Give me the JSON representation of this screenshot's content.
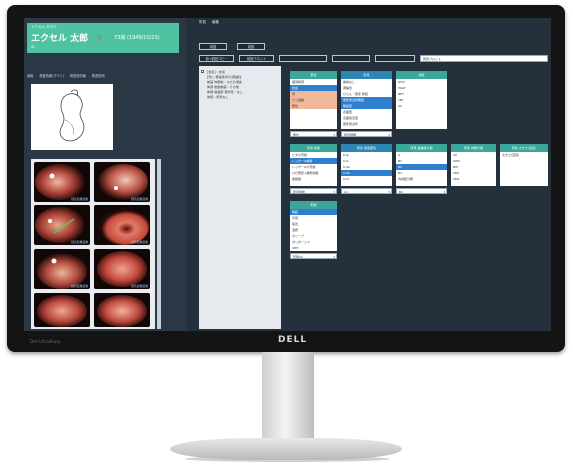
{
  "patient": {
    "kana": "エクセル タロウ",
    "name": "エクセル 太郎",
    "gender_symbol": "♀",
    "age_dob": "73歳 (1949/10/23)",
    "id": "ID"
  },
  "left_tabs": [
    "画像",
    "検査情報(すべて)",
    "検査前情報",
    "検査説明"
  ],
  "thumb_label": "検査画像画像",
  "menu": [
    "所見",
    "編集"
  ],
  "toolbar": {
    "row1": [
      "前回",
      "前回"
    ],
    "row2": [
      "前→前回コピー",
      "前回プロット",
      "",
      "",
      ""
    ],
    "field_value": "所見プロット"
  },
  "findings": [
    "[食道] : 食道",
    "[胃] : 萎縮性胃炎/萎縮性",
    "前庭 体部前 : ひだの消失",
    "体部 後壁前庭 : その他",
    "体部 前庭部 有所見 : なし",
    "体部 : 所見なし"
  ],
  "groups": {
    "region": {
      "title": "部位",
      "items": [
        "咽頭喉頭",
        "食道",
        "胃",
        "十二指腸",
        "部位"
      ],
      "footer": "部位"
    },
    "finding": {
      "title": "所見",
      "items": [
        "異常なし",
        "萎縮性",
        "びらん・発赤 隆起",
        "発赤斑点状隆起",
        "隆起型",
        "表面型",
        "表面陥凹型",
        "発赤斑点状"
      ],
      "footer": "所見詳細"
    },
    "diagnosis": {
      "title": "診断",
      "items": [
        "GIST",
        "MALT",
        "NET",
        "LBT",
        "AC"
      ]
    },
    "detail_row": [
      {
        "title": "所見 前後",
        "items": [
          "ヒダ小弯前",
          "レッサーG前壁",
          "レッサーG大弯前",
          "ひだ発赤+腫瘍前壁",
          "後壁壁"
        ],
        "footer": "所見前後"
      },
      {
        "title": "所見 病変部位",
        "items": [
          "0-Ip",
          "0-Is",
          "0-IIa",
          "0-IIb",
          "0-IIc",
          "0-III"
        ],
        "footer": "0-I"
      },
      {
        "title": "所見 進展度分類",
        "items": [
          "A",
          "B1",
          "B2",
          "B3",
          "内視鏡分類"
        ],
        "footer": "B1"
      },
      {
        "title": "所見 肉眼分類",
        "items": [
          "UP",
          "UPM",
          "NM",
          "SM1",
          "SM2"
        ],
        "footer": ""
      },
      {
        "title": "所見 大きさ(直径)",
        "items": [
          "大きさ(直径)"
        ],
        "footer": ""
      }
    ],
    "morph": {
      "title": "形態",
      "items": [
        "隆起",
        "平坦",
        "陥凹",
        "潰瘍",
        "ポリープ",
        "ポリポーシス",
        "SMT"
      ],
      "footer": "形態なし"
    }
  },
  "monitor": {
    "brand": "DELL",
    "model_text": "Dell UltraSharp"
  }
}
